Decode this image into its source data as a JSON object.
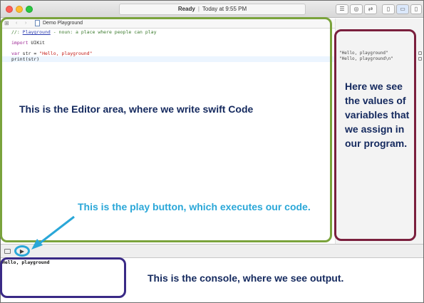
{
  "window": {
    "status_state": "Ready",
    "status_time": "Today at 9:55 PM"
  },
  "jumpbar": {
    "file_name": "Demo Playground"
  },
  "editor": {
    "lines": {
      "l1_prefix": "//: ",
      "l1_link": "Playground",
      "l1_rest": " - noun: a place where people can play",
      "l2_kw": "import",
      "l2_rest": " UIKit",
      "l3_kw": "var",
      "l3_mid": " str = ",
      "l3_str": "\"Hello, playground\"",
      "l4": "print(str)"
    }
  },
  "results": {
    "r1": "\"Hello, playground\"",
    "r2": "\"Hello, playground\\n\""
  },
  "console": {
    "output": "Hello, playground"
  },
  "annotations": {
    "editor": "This is the Editor area, where we write swift Code",
    "results": "Here we see the values of variables that we assign in our program.",
    "play": "This is the play button, which executes our code.",
    "console": "This is the console, where we see output."
  },
  "colors": {
    "editor_box": "#7aa33c",
    "results_box": "#7a1f3d",
    "console_box": "#3a2a86",
    "play_highlight": "#2aa7d8",
    "annotation_text": "#14295e"
  }
}
